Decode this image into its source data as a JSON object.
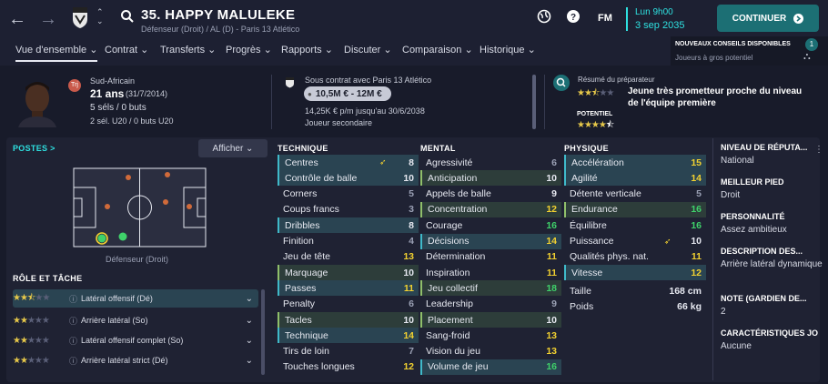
{
  "header": {
    "title": "35. HAPPY MALULEKE",
    "subtitle": "Défenseur (Droit) / AL (D) - Paris 13 Atlético",
    "fm_label": "FM",
    "date_time": "Lun 9h00",
    "date": "3 sep 2035",
    "continue_label": "CONTINUER"
  },
  "menu": [
    {
      "label": "Vue d'ensemble ⌄"
    },
    {
      "label": "Contrat ⌄"
    },
    {
      "label": "Transferts ⌄"
    },
    {
      "label": "Progrès ⌄"
    },
    {
      "label": "Rapports ⌄"
    },
    {
      "label": "Discuter ⌄"
    },
    {
      "label": "Comparaison ⌄"
    },
    {
      "label": "Historique ⌄"
    }
  ],
  "notification": {
    "title": "NOUVEAUX CONSEILS DISPONIBLES",
    "text": "Joueurs à gros potentiel",
    "count": "1"
  },
  "profile": {
    "nationality": "Sud-Africain",
    "age": "21 ans",
    "birth": "(31/7/2014)",
    "caps": "5 séls / 0 buts",
    "u20": "2 sél. U20 / 0 buts U20",
    "badge": "Trj"
  },
  "contract": {
    "status": "Sous contrat avec Paris 13 Atlético",
    "value": "10,5M € - 12M €",
    "wage": "14,25K € p/m jusqu'au 30/6/2038",
    "role": "Joueur secondaire"
  },
  "scout": {
    "label": "Résumé du préparateur",
    "summary": "Jeune très prometteur proche du niveau de l'équipe première",
    "potential_label": "POTENTIEL",
    "ability_stars": 2.5,
    "potential_stars": 4.5
  },
  "positions": {
    "header": "POSTES >",
    "show_label": "Afficher ⌄",
    "caption": "Défenseur (Droit)"
  },
  "roles": {
    "header": "RÔLE ET TÂCHE",
    "items": [
      {
        "label": "Latéral offensif (Dé)",
        "stars": 2.5
      },
      {
        "label": "Arrière latéral (So)",
        "stars": 2
      },
      {
        "label": "Latéral offensif complet (So)",
        "stars": 2
      },
      {
        "label": "Arrière latéral strict (Dé)",
        "stars": 2
      }
    ]
  },
  "technique": {
    "header": "TECHNIQUE",
    "items": [
      {
        "name": "Centres",
        "value": "8"
      },
      {
        "name": "Contrôle de balle",
        "value": "10"
      },
      {
        "name": "Corners",
        "value": "5"
      },
      {
        "name": "Coups francs",
        "value": "3"
      },
      {
        "name": "Dribbles",
        "value": "8"
      },
      {
        "name": "Finition",
        "value": "4"
      },
      {
        "name": "Jeu de tête",
        "value": "13"
      },
      {
        "name": "Marquage",
        "value": "10"
      },
      {
        "name": "Passes",
        "value": "11"
      },
      {
        "name": "Penalty",
        "value": "6"
      },
      {
        "name": "Tacles",
        "value": "10"
      },
      {
        "name": "Technique",
        "value": "14"
      },
      {
        "name": "Tirs de loin",
        "value": "7"
      },
      {
        "name": "Touches longues",
        "value": "12"
      }
    ]
  },
  "mental": {
    "header": "MENTAL",
    "items": [
      {
        "name": "Agressivité",
        "value": "6"
      },
      {
        "name": "Anticipation",
        "value": "10"
      },
      {
        "name": "Appels de balle",
        "value": "9"
      },
      {
        "name": "Concentration",
        "value": "12"
      },
      {
        "name": "Courage",
        "value": "16"
      },
      {
        "name": "Décisions",
        "value": "14"
      },
      {
        "name": "Détermination",
        "value": "11"
      },
      {
        "name": "Inspiration",
        "value": "11"
      },
      {
        "name": "Jeu collectif",
        "value": "18"
      },
      {
        "name": "Leadership",
        "value": "9"
      },
      {
        "name": "Placement",
        "value": "10"
      },
      {
        "name": "Sang-froid",
        "value": "13"
      },
      {
        "name": "Vision du jeu",
        "value": "13"
      },
      {
        "name": "Volume de jeu",
        "value": "16"
      }
    ]
  },
  "physique": {
    "header": "PHYSIQUE",
    "items": [
      {
        "name": "Accélération",
        "value": "15"
      },
      {
        "name": "Agilité",
        "value": "14"
      },
      {
        "name": "Détente verticale",
        "value": "5"
      },
      {
        "name": "Endurance",
        "value": "16"
      },
      {
        "name": "Équilibre",
        "value": "16"
      },
      {
        "name": "Puissance",
        "value": "10"
      },
      {
        "name": "Qualités phys. nat.",
        "value": "11"
      },
      {
        "name": "Vitesse",
        "value": "12"
      }
    ],
    "height_label": "Taille",
    "height": "168 cm",
    "weight_label": "Poids",
    "weight": "66 kg"
  },
  "side": {
    "items": [
      {
        "header": "NIVEAU DE RÉPUTA...",
        "value": "National"
      },
      {
        "header": "MEILLEUR PIED",
        "value": "Droit"
      },
      {
        "header": "PERSONNALITÉ",
        "value": "Assez ambitieux"
      },
      {
        "header": "DESCRIPTION DES...",
        "value": "Arrière latéral dynamique"
      },
      {
        "header": "NOTE (GARDIEN DE...",
        "value": "2"
      },
      {
        "header": "CARACTÉRISTIQUES JO",
        "value": "Aucune"
      }
    ]
  },
  "colors": {
    "accent": "#2ee0e0",
    "continue_bg": "#1c6f74",
    "value_yellow": "#f2d130",
    "value_green": "#3fd16a",
    "star": "#e6c84a"
  }
}
